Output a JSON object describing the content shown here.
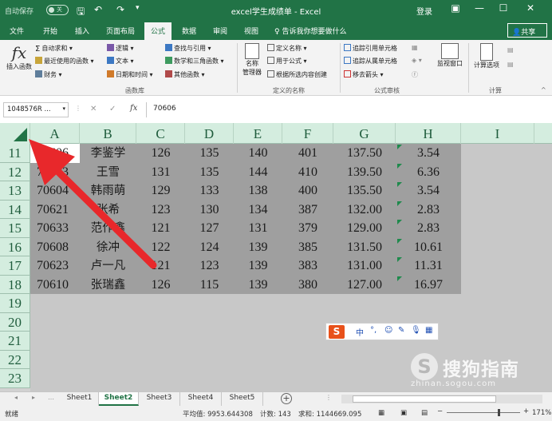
{
  "titlebar": {
    "autosave": "自动保存",
    "autosave_state": "关",
    "title": "excel学生成绩单  -  Excel",
    "login": "登录",
    "ribbon_display": "▣",
    "minimize": "—",
    "maximize": "☐",
    "close": "✕"
  },
  "tabs": [
    {
      "label": "文件"
    },
    {
      "label": "开始"
    },
    {
      "label": "插入"
    },
    {
      "label": "页面布局"
    },
    {
      "label": "公式"
    },
    {
      "label": "数据"
    },
    {
      "label": "审阅"
    },
    {
      "label": "视图"
    }
  ],
  "tellme": "告诉我你想要做什么",
  "share": "共享",
  "ribbon": {
    "insert_function": "插入函数",
    "autosum": "自动求和",
    "recent": "最近使用的函数",
    "financial": "财务",
    "logical": "逻辑",
    "text": "文本",
    "datetime": "日期和时间",
    "lookup": "查找与引用",
    "math": "数学和三角函数",
    "other": "其他函数",
    "group_library": "函数库",
    "name_manager_1": "名称",
    "name_manager_2": "管理器",
    "define_name": "定义名称",
    "use_in_formula": "用于公式",
    "create_from_selection": "根据所选内容创建",
    "group_names": "定义的名称",
    "trace_precedents": "追踪引用单元格",
    "trace_dependents": "追踪从属单元格",
    "remove_arrows": "移去箭头",
    "group_audit": "公式审核",
    "watch_window": "监视窗口",
    "calc_options": "计算选项",
    "group_calc": "计算"
  },
  "formula_bar": {
    "name_box": "1048576R ...",
    "value": "70606"
  },
  "columns": [
    "A",
    "B",
    "C",
    "D",
    "E",
    "F",
    "G",
    "H",
    "I"
  ],
  "row_numbers": [
    "11",
    "12",
    "13",
    "14",
    "15",
    "16",
    "17",
    "18",
    "19",
    "20",
    "21",
    "22",
    "23"
  ],
  "rows": [
    [
      "70606",
      "李鉴学",
      "126",
      "135",
      "140",
      "401",
      "137.50",
      "3.54"
    ],
    [
      "70603",
      "王雪",
      "131",
      "135",
      "144",
      "410",
      "139.50",
      "6.36"
    ],
    [
      "70604",
      "韩雨萌",
      "129",
      "133",
      "138",
      "400",
      "135.50",
      "3.54"
    ],
    [
      "70621",
      "张希",
      "123",
      "130",
      "134",
      "387",
      "132.00",
      "2.83"
    ],
    [
      "70633",
      "范作鑫",
      "121",
      "127",
      "131",
      "379",
      "129.00",
      "2.83"
    ],
    [
      "70608",
      "徐冲",
      "122",
      "124",
      "139",
      "385",
      "131.50",
      "10.61"
    ],
    [
      "70623",
      "卢一凡",
      "121",
      "123",
      "139",
      "383",
      "131.00",
      "11.31"
    ],
    [
      "70610",
      "张瑞鑫",
      "126",
      "115",
      "139",
      "380",
      "127.00",
      "16.97"
    ]
  ],
  "ime": {
    "logo": "S",
    "mode": "中",
    "punct": "°,",
    "emoji": "☺",
    "pen": "✎",
    "mic": "🎙",
    "grid": "▦"
  },
  "sheets": [
    "Sheet1",
    "Sheet2",
    "Sheet3",
    "Sheet4",
    "Sheet5"
  ],
  "status": {
    "ready": "就绪",
    "average": "平均值: 9953.644308",
    "count": "计数: 143",
    "sum": "求和: 1144669.095",
    "zoom": "171%"
  },
  "watermark": {
    "brand": "搜狗指南",
    "url": "zhinan.sogou.com"
  },
  "colors": {
    "excel_green": "#217346",
    "selection": "#9f9f9f",
    "arrow": "#e8282b"
  }
}
